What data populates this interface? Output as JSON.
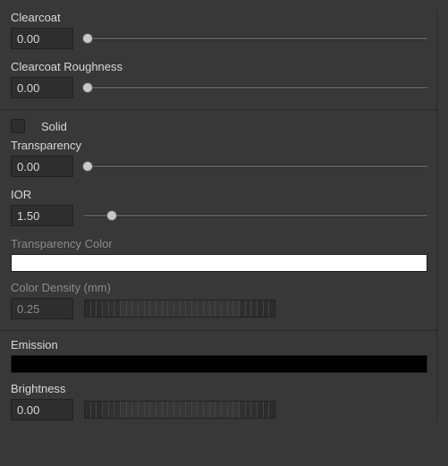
{
  "clearcoat": {
    "label": "Clearcoat",
    "value": "0.00",
    "slider_pct": 1
  },
  "clearcoat_roughness": {
    "label": "Clearcoat Roughness",
    "value": "0.00",
    "slider_pct": 1
  },
  "solid": {
    "label": "Solid",
    "checked": false
  },
  "transparency": {
    "label": "Transparency",
    "value": "0.00",
    "slider_pct": 1
  },
  "ior": {
    "label": "IOR",
    "value": "1.50",
    "slider_pct": 8
  },
  "transparency_color": {
    "label": "Transparency Color",
    "color": "#ffffff",
    "enabled": false
  },
  "color_density": {
    "label": "Color Density (mm)",
    "value": "0.25",
    "enabled": false
  },
  "emission": {
    "label": "Emission",
    "color": "#000000"
  },
  "brightness": {
    "label": "Brightness",
    "value": "0.00"
  }
}
